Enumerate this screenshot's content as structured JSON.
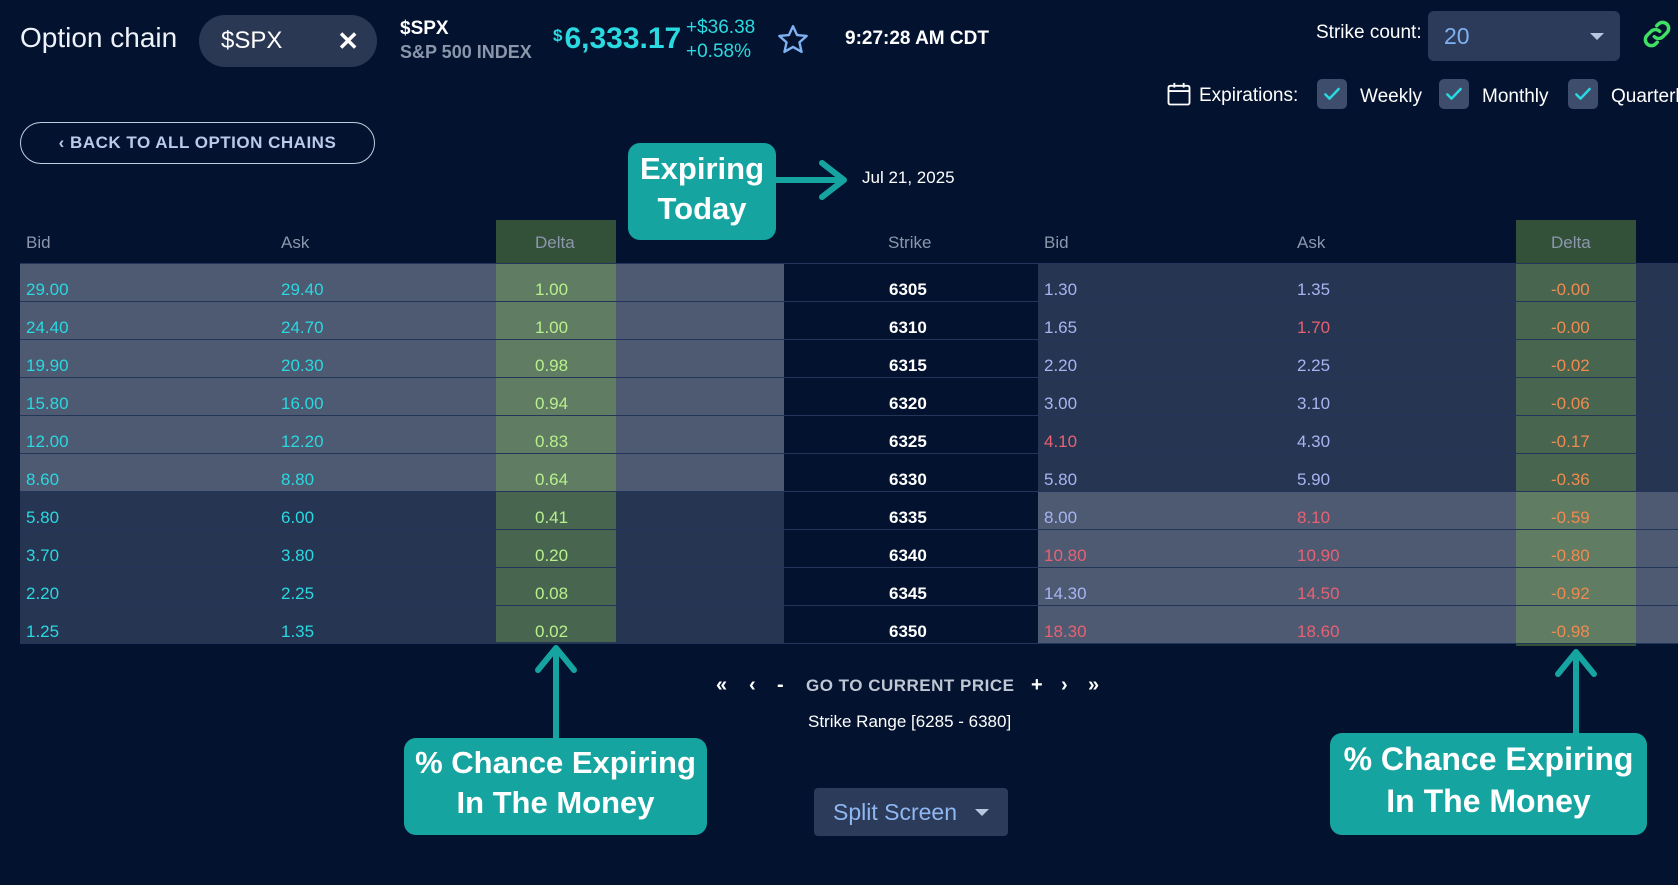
{
  "header": {
    "title": "Option chain",
    "search_value": "$SPX",
    "symbol": "$SPX",
    "description": "S&P 500 INDEX",
    "price_currency": "$",
    "price": "6,333.17",
    "change": "+$36.38",
    "change_pct": "+0.58%",
    "time": "9:27:28 AM CDT",
    "strike_count_label": "Strike count:",
    "strike_count_value": "20",
    "expirations_label": "Expirations:",
    "expiration_options": [
      {
        "label": "Weekly",
        "checked": true
      },
      {
        "label": "Monthly",
        "checked": true
      },
      {
        "label": "Quarterl",
        "checked": true
      }
    ]
  },
  "back_button": "‹ BACK TO ALL OPTION CHAINS",
  "expiration_date": "Jul 21, 2025",
  "columns": {
    "call_bid": "Bid",
    "call_ask": "Ask",
    "call_delta": "Delta",
    "strike": "Strike",
    "put_bid": "Bid",
    "put_ask": "Ask",
    "put_delta": "Delta"
  },
  "rows": [
    {
      "call_bid": "29.00",
      "call_ask": "29.40",
      "call_delta": "1.00",
      "strike": "6305",
      "put_bid": "1.30",
      "put_ask": "1.35",
      "put_delta": "-0.00"
    },
    {
      "call_bid": "24.40",
      "call_ask": "24.70",
      "call_delta": "1.00",
      "strike": "6310",
      "put_bid": "1.65",
      "put_ask": "1.70",
      "put_delta": "-0.00"
    },
    {
      "call_bid": "19.90",
      "call_ask": "20.30",
      "call_delta": "0.98",
      "strike": "6315",
      "put_bid": "2.20",
      "put_ask": "2.25",
      "put_delta": "-0.02"
    },
    {
      "call_bid": "15.80",
      "call_ask": "16.00",
      "call_delta": "0.94",
      "strike": "6320",
      "put_bid": "3.00",
      "put_ask": "3.10",
      "put_delta": "-0.06"
    },
    {
      "call_bid": "12.00",
      "call_ask": "12.20",
      "call_delta": "0.83",
      "strike": "6325",
      "put_bid": "4.10",
      "put_ask": "4.30",
      "put_delta": "-0.17"
    },
    {
      "call_bid": "8.60",
      "call_ask": "8.80",
      "call_delta": "0.64",
      "strike": "6330",
      "put_bid": "5.80",
      "put_ask": "5.90",
      "put_delta": "-0.36"
    },
    {
      "call_bid": "5.80",
      "call_ask": "6.00",
      "call_delta": "0.41",
      "strike": "6335",
      "put_bid": "8.00",
      "put_ask": "8.10",
      "put_delta": "-0.59"
    },
    {
      "call_bid": "3.70",
      "call_ask": "3.80",
      "call_delta": "0.20",
      "strike": "6340",
      "put_bid": "10.80",
      "put_ask": "10.90",
      "put_delta": "-0.80"
    },
    {
      "call_bid": "2.20",
      "call_ask": "2.25",
      "call_delta": "0.08",
      "strike": "6345",
      "put_bid": "14.30",
      "put_ask": "14.50",
      "put_delta": "-0.92"
    },
    {
      "call_bid": "1.25",
      "call_ask": "1.35",
      "call_delta": "0.02",
      "strike": "6350",
      "put_bid": "18.30",
      "put_ask": "18.60",
      "put_delta": "-0.98"
    }
  ],
  "put_bid_colors": [
    "lav",
    "lav",
    "lav",
    "lav",
    "red",
    "lav",
    "lav",
    "red",
    "lav",
    "red"
  ],
  "put_ask_colors": [
    "lav",
    "red",
    "lav",
    "lav",
    "lav",
    "lav",
    "red",
    "red",
    "red",
    "red"
  ],
  "pager": {
    "first": "«",
    "prev": "‹",
    "minus": "-",
    "goto_label": "GO TO CURRENT PRICE",
    "plus": "+",
    "next": "›",
    "last": "»",
    "range": "Strike Range [6285 - 6380]"
  },
  "split_screen": "Split Screen",
  "annotations": {
    "expiring_line1": "Expiring",
    "expiring_line2": "Today",
    "itm_line1": "% Chance Expiring",
    "itm_line2": "In The Money"
  },
  "colors": {
    "background": "#03122e",
    "accent_cyan": "#2ad8e0",
    "callout_teal": "#16a4a1",
    "delta_green": "#7eb04a",
    "put_red": "#e86173"
  }
}
